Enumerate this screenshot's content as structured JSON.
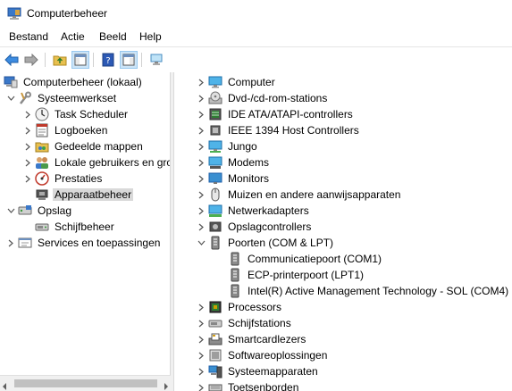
{
  "window": {
    "title": "Computerbeheer"
  },
  "menu": [
    "Bestand",
    "Actie",
    "Beeld",
    "Help"
  ],
  "left_tree": [
    {
      "label": "Computerbeheer (lokaal)",
      "icon": "computer-management-icon",
      "level": 0,
      "chevron": ""
    },
    {
      "label": "Systeemwerkset",
      "icon": "system-tools-icon",
      "level": 1,
      "chevron": "down"
    },
    {
      "label": "Task Scheduler",
      "icon": "clock-icon",
      "level": 2,
      "chevron": "right"
    },
    {
      "label": "Logboeken",
      "icon": "event-viewer-icon",
      "level": 2,
      "chevron": "right"
    },
    {
      "label": "Gedeelde mappen",
      "icon": "shared-folder-icon",
      "level": 2,
      "chevron": "right"
    },
    {
      "label": "Lokale gebruikers en gro",
      "icon": "users-icon",
      "level": 2,
      "chevron": "right"
    },
    {
      "label": "Prestaties",
      "icon": "performance-icon",
      "level": 2,
      "chevron": "right"
    },
    {
      "label": "Apparaatbeheer",
      "icon": "device-manager-icon",
      "level": 2,
      "chevron": "",
      "selected": true
    },
    {
      "label": "Opslag",
      "icon": "storage-icon",
      "level": 1,
      "chevron": "down"
    },
    {
      "label": "Schijfbeheer",
      "icon": "disk-management-icon",
      "level": 2,
      "chevron": ""
    },
    {
      "label": "Services en toepassingen",
      "icon": "services-icon",
      "level": 1,
      "chevron": "right"
    }
  ],
  "right_tree": [
    {
      "label": "Computer",
      "icon": "monitor-icon",
      "level": 0,
      "chevron": "right"
    },
    {
      "label": "Dvd-/cd-rom-stations",
      "icon": "dvd-drive-icon",
      "level": 0,
      "chevron": "right"
    },
    {
      "label": "IDE ATA/ATAPI-controllers",
      "icon": "ide-controller-icon",
      "level": 0,
      "chevron": "right"
    },
    {
      "label": "IEEE 1394 Host Controllers",
      "icon": "firewire-icon",
      "level": 0,
      "chevron": "right"
    },
    {
      "label": "Jungo",
      "icon": "jungo-device-icon",
      "level": 0,
      "chevron": "right"
    },
    {
      "label": "Modems",
      "icon": "modem-icon",
      "level": 0,
      "chevron": "right"
    },
    {
      "label": "Monitors",
      "icon": "display-monitor-icon",
      "level": 0,
      "chevron": "right"
    },
    {
      "label": "Muizen en andere aanwijsapparaten",
      "icon": "mouse-icon",
      "level": 0,
      "chevron": "right"
    },
    {
      "label": "Netwerkadapters",
      "icon": "network-adapter-icon",
      "level": 0,
      "chevron": "right"
    },
    {
      "label": "Opslagcontrollers",
      "icon": "storage-controller-icon",
      "level": 0,
      "chevron": "right"
    },
    {
      "label": "Poorten (COM & LPT)",
      "icon": "port-icon",
      "level": 0,
      "chevron": "down"
    },
    {
      "label": "Communicatiepoort (COM1)",
      "icon": "port-icon",
      "level": 1,
      "chevron": ""
    },
    {
      "label": "ECP-printerpoort (LPT1)",
      "icon": "port-icon",
      "level": 1,
      "chevron": ""
    },
    {
      "label": "Intel(R) Active Management Technology - SOL (COM4)",
      "icon": "port-icon",
      "level": 1,
      "chevron": ""
    },
    {
      "label": "Processors",
      "icon": "processor-icon",
      "level": 0,
      "chevron": "right"
    },
    {
      "label": "Schijfstations",
      "icon": "disk-drive-icon",
      "level": 0,
      "chevron": "right"
    },
    {
      "label": "Smartcardlezers",
      "icon": "smartcard-reader-icon",
      "level": 0,
      "chevron": "right"
    },
    {
      "label": "Softwareoplossingen",
      "icon": "software-component-icon",
      "level": 0,
      "chevron": "right"
    },
    {
      "label": "Systeemapparaten",
      "icon": "system-devices-icon",
      "level": 0,
      "chevron": "right"
    },
    {
      "label": "Toetsenborden",
      "icon": "keyboard-icon",
      "level": 0,
      "chevron": "right"
    }
  ]
}
